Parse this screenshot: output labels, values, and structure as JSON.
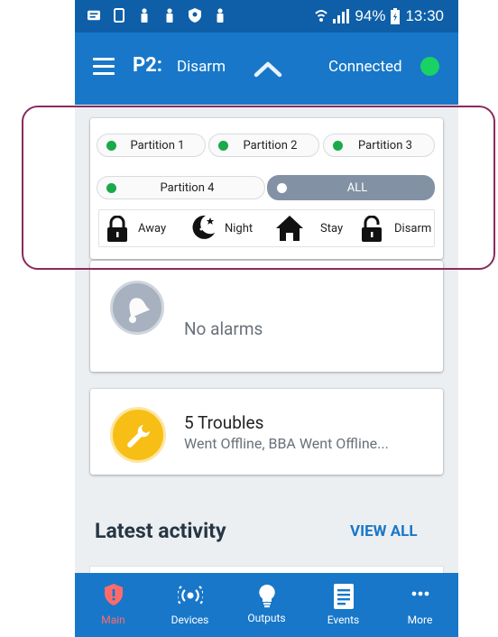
{
  "status_bar": {
    "battery": "94%",
    "time": "13:30"
  },
  "header": {
    "partition_id": "P2:",
    "partition_state": "Disarm",
    "connection": "Connected",
    "colors": {
      "connected": "#19d264",
      "header_bg": "#1877c9"
    }
  },
  "partitions": [
    {
      "label": "Partition 1"
    },
    {
      "label": "Partition 2"
    },
    {
      "label": "Partition 3"
    },
    {
      "label": "Partition 4"
    }
  ],
  "all_button": {
    "label": "ALL"
  },
  "arm_modes": [
    {
      "label": "Away",
      "icon": "lock-icon"
    },
    {
      "label": "Night",
      "icon": "moon-icon"
    },
    {
      "label": "Stay",
      "icon": "home-icon"
    },
    {
      "label": "Disarm",
      "icon": "unlock-icon"
    }
  ],
  "alarms": {
    "text": "No alarms"
  },
  "troubles": {
    "title": "5 Troubles",
    "detail": "Went Offline, BBA Went Offline..."
  },
  "activity": {
    "heading": "Latest activity",
    "view_all": "VIEW ALL"
  },
  "bottom_nav": [
    {
      "label": "Main",
      "icon": "shield-icon",
      "active": true
    },
    {
      "label": "Devices",
      "icon": "devices-icon"
    },
    {
      "label": "Outputs",
      "icon": "bulb-icon"
    },
    {
      "label": "Events",
      "icon": "document-icon"
    },
    {
      "label": "More",
      "icon": "more-icon"
    }
  ]
}
